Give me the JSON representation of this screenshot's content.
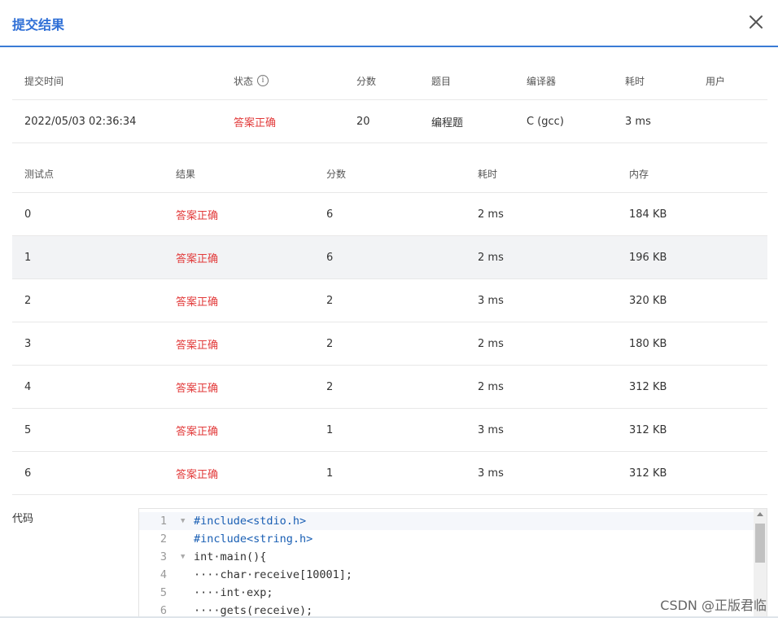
{
  "dialog": {
    "title": "提交结果",
    "close_icon": "close-icon"
  },
  "submission": {
    "headers": {
      "time": "提交时间",
      "status": "状态",
      "score": "分数",
      "problem": "题目",
      "compiler": "编译器",
      "duration": "耗时",
      "user": "用户"
    },
    "values": {
      "time": "2022/05/03 02:36:34",
      "status": "答案正确",
      "score": "20",
      "problem": "编程题",
      "compiler": "C (gcc)",
      "duration": "3 ms",
      "user": ""
    },
    "info_icon": "info-icon",
    "status_color": "#e23b3b"
  },
  "tests": {
    "headers": {
      "case": "测试点",
      "result": "结果",
      "score": "分数",
      "duration": "耗时",
      "memory": "内存"
    },
    "rows": [
      {
        "case": "0",
        "result": "答案正确",
        "score": "6",
        "duration": "2 ms",
        "memory": "184 KB"
      },
      {
        "case": "1",
        "result": "答案正确",
        "score": "6",
        "duration": "2 ms",
        "memory": "196 KB"
      },
      {
        "case": "2",
        "result": "答案正确",
        "score": "2",
        "duration": "3 ms",
        "memory": "320 KB"
      },
      {
        "case": "3",
        "result": "答案正确",
        "score": "2",
        "duration": "2 ms",
        "memory": "180 KB"
      },
      {
        "case": "4",
        "result": "答案正确",
        "score": "2",
        "duration": "2 ms",
        "memory": "312 KB"
      },
      {
        "case": "5",
        "result": "答案正确",
        "score": "1",
        "duration": "3 ms",
        "memory": "312 KB"
      },
      {
        "case": "6",
        "result": "答案正确",
        "score": "1",
        "duration": "3 ms",
        "memory": "312 KB"
      }
    ]
  },
  "code": {
    "label": "代码",
    "lines": [
      {
        "num": "1",
        "text": "#include<stdio.h>"
      },
      {
        "num": "2",
        "text": "#include<string.h>"
      },
      {
        "num": "3",
        "text": "int·main(){"
      },
      {
        "num": "4",
        "text": "····char·receive[10001];"
      },
      {
        "num": "5",
        "text": "····int·exp;"
      },
      {
        "num": "6",
        "text": "····gets(receive);"
      }
    ]
  },
  "watermark": "CSDN @正版君临"
}
